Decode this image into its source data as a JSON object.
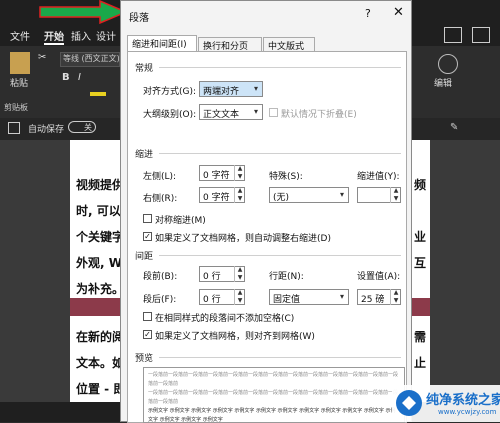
{
  "word": {
    "menu": [
      "文件",
      "开始",
      "插入",
      "设计"
    ],
    "font_box": "等线 (西文正文)",
    "ribbon_groups": [
      "粘贴",
      "剪贴板",
      "编辑"
    ],
    "autosave_label": "自动保存",
    "autosave_state": "关",
    "doc_lines": [
      "视频提供",
      "时, 可以在",
      "个关键字",
      "外观, W",
      "为补充。",
      "在新的阅",
      "文本。如",
      "位置 - 即"
    ],
    "right_fragments": [
      "频",
      "",
      "业",
      "互",
      "",
      "需",
      "止",
      ""
    ]
  },
  "dialog": {
    "title": "段落",
    "help": "?",
    "close": "✕",
    "tabs": [
      "缩进和间距(I)",
      "换行和分页(P)",
      "中文版式(H)"
    ],
    "general": {
      "heading": "常规",
      "alignment_label": "对齐方式(G):",
      "alignment_value": "两端对齐",
      "outline_label": "大纲级别(O):",
      "outline_value": "正文文本",
      "collapse_label": "默认情况下折叠(E)"
    },
    "indent": {
      "heading": "缩进",
      "left_label": "左侧(L):",
      "left_value": "0 字符",
      "right_label": "右侧(R):",
      "right_value": "0 字符",
      "special_label": "特殊(S):",
      "special_value": "(无)",
      "indent_by_label": "缩进值(Y):",
      "indent_by_value": "",
      "mirror_label": "对称缩进(M)",
      "auto_adjust_label": "如果定义了文档网格，则自动调整右缩进(D)"
    },
    "spacing": {
      "heading": "间距",
      "before_label": "段前(B):",
      "before_value": "0 行",
      "after_label": "段后(F):",
      "after_value": "0 行",
      "line_spacing_label": "行距(N):",
      "line_spacing_value": "固定值",
      "at_label": "设置值(A):",
      "at_value": "25 磅",
      "no_space_label": "在相同样式的段落间不添加空格(C)",
      "snap_grid_label": "如果定义了文档网格，则对齐到网格(W)"
    },
    "preview": {
      "heading": "预览",
      "prev_para": "一段落前一段落前一段落前一段落前一段落前一段落前一段落前一段落前一段落前一段落前一段落前一段落前一段落前一段落前",
      "sample": "示例文字 示例文字 示例文字 示例文字 示例文字 示例文字 示例文字 示例文字 示例文字 示例文字 示例文字 示例文字 示例文字 示例文字 示例文字"
    }
  },
  "watermark": {
    "text": "纯净系统之家",
    "url": "www.ycwjzy.com"
  },
  "colors": {
    "arrow": "#1aa84a",
    "arrow_outline": "#e02020",
    "selection": "#cde4f7",
    "watermark_blue": "#1a6fc9"
  }
}
